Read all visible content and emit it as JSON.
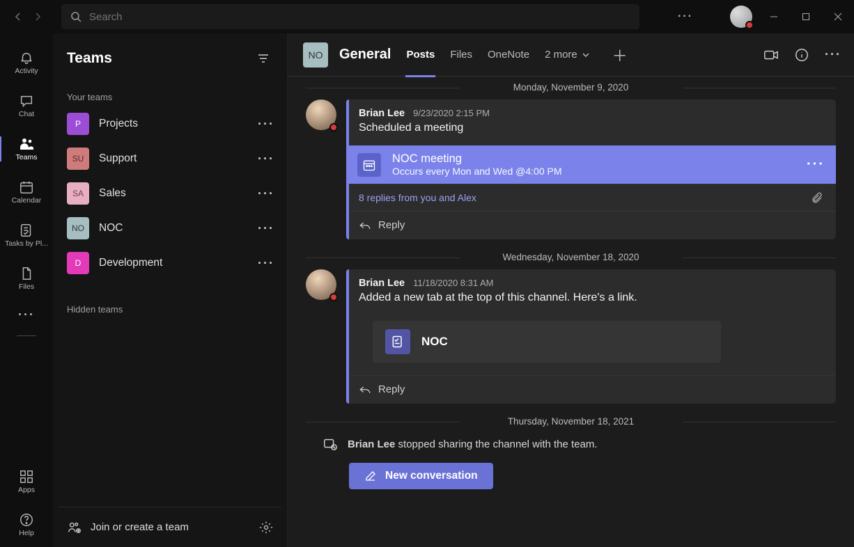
{
  "titlebar": {
    "search_placeholder": "Search"
  },
  "rail": {
    "activity": "Activity",
    "chat": "Chat",
    "teams": "Teams",
    "calendar": "Calendar",
    "tasks": "Tasks by Pl...",
    "files": "Files",
    "apps": "Apps",
    "help": "Help"
  },
  "sidebar": {
    "title": "Teams",
    "group_your_teams": "Your teams",
    "group_hidden_teams": "Hidden teams",
    "teams": [
      {
        "initials": "P",
        "name": "Projects",
        "color": "#9b4dd6"
      },
      {
        "initials": "SU",
        "name": "Support",
        "color": "#cf7b7b"
      },
      {
        "initials": "SA",
        "name": "Sales",
        "color": "#cf7b9b"
      },
      {
        "initials": "NO",
        "name": "NOC",
        "color": "#a6bec0"
      },
      {
        "initials": "D",
        "name": "Development",
        "color": "#e23ab8"
      }
    ],
    "join_create": "Join or create a team"
  },
  "channel": {
    "tile": "NO",
    "name": "General",
    "tabs": {
      "posts": "Posts",
      "files": "Files",
      "onenote": "OneNote",
      "more": "2 more"
    }
  },
  "feed": {
    "date1": "Monday, November 9, 2020",
    "msg1": {
      "author": "Brian Lee",
      "time": "9/23/2020 2:15 PM",
      "body": "Scheduled a meeting",
      "meeting_title": "NOC meeting",
      "meeting_sub": "Occurs every Mon and Wed @4:00 PM",
      "replies": "8 replies from you and Alex",
      "reply": "Reply"
    },
    "date2": "Wednesday, November 18, 2020",
    "msg2": {
      "author": "Brian Lee",
      "time": "11/18/2020 8:31 AM",
      "body": "Added a new tab at the top of this channel. Here's a link.",
      "link_title": "NOC",
      "reply": "Reply"
    },
    "date3": "Thursday, November 18, 2021",
    "system": {
      "author": "Brian Lee",
      "text": " stopped sharing the channel with the team."
    },
    "new_conversation": "New conversation"
  }
}
